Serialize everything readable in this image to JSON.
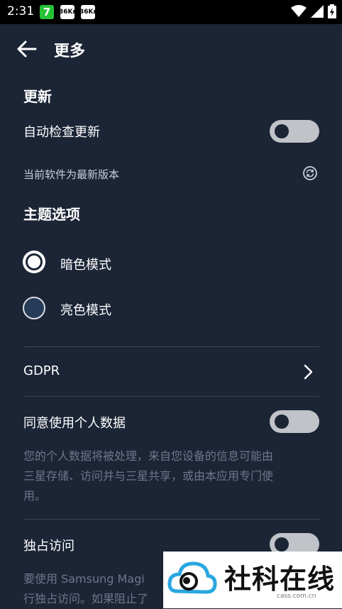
{
  "status_bar": {
    "time": "2:31",
    "notifications": [
      "7",
      "36Kr",
      "36Kr"
    ]
  },
  "header": {
    "title": "更多"
  },
  "update_section": {
    "title": "更新",
    "auto_check_label": "自动检查更新",
    "auto_check_on": false,
    "status_text": "当前软件为最新版本"
  },
  "theme_section": {
    "title": "主题选项",
    "options": [
      {
        "label": "暗色模式",
        "selected": true
      },
      {
        "label": "亮色模式",
        "selected": false
      }
    ]
  },
  "gdpr": {
    "label": "GDPR"
  },
  "personal_data": {
    "label": "同意使用个人数据",
    "enabled": false,
    "description": [
      "您的个人数据将被处理，来自您设备的信息可能由",
      "三星存储、访问并与三星共享，或由本应用专门使",
      "用。"
    ]
  },
  "exclusive_access": {
    "label": "独占访问",
    "enabled": false,
    "description": [
      "要使用 Samsung Magi",
      "行独占访问。如果阻止了"
    ]
  },
  "watermark": {
    "text": "社科在线",
    "url": "cass.com.cn"
  },
  "colors": {
    "background": "#1c2536",
    "toggle_off": "#c0c3c8",
    "muted_text": "#6d778a"
  }
}
